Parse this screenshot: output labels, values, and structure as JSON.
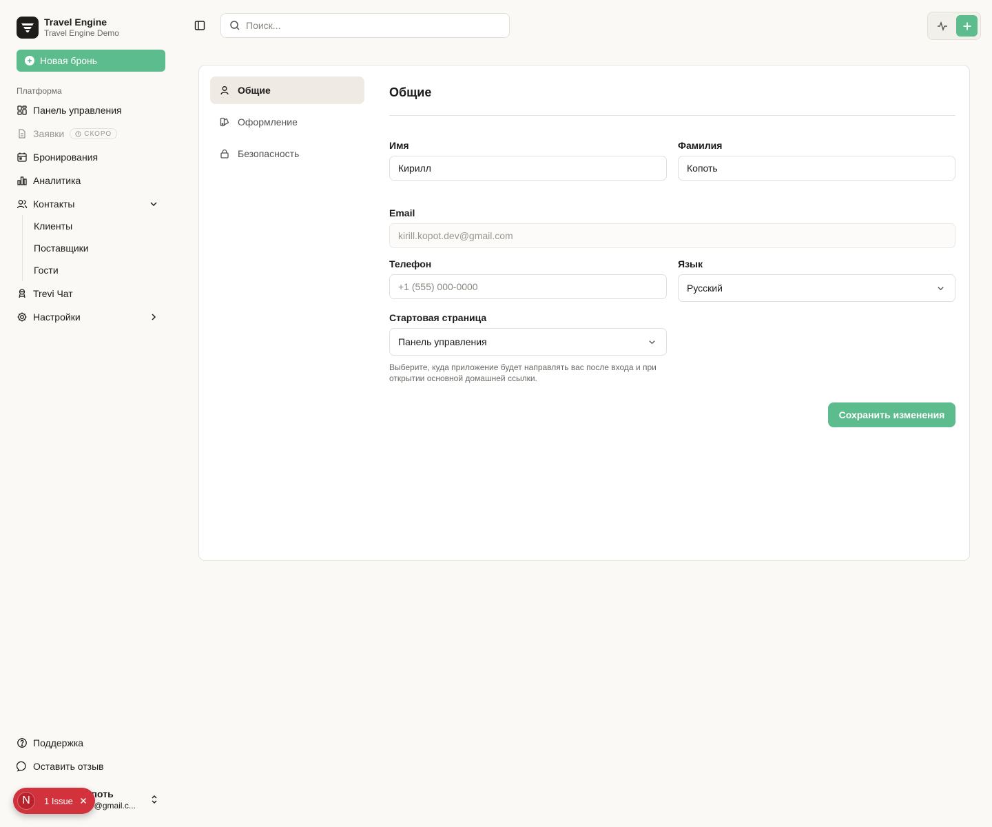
{
  "app": {
    "name": "Travel Engine",
    "workspace": "Travel Engine Demo"
  },
  "sidebar": {
    "new_booking_label": "Новая бронь",
    "group_label": "Платформа",
    "items": {
      "dashboard": "Панель управления",
      "requests": "Заявки",
      "requests_badge": "СКОРО",
      "bookings": "Бронирования",
      "analytics": "Аналитика",
      "contacts": "Контакты",
      "trevi_chat": "Trevi Чат",
      "settings": "Настройки"
    },
    "contacts_sub": {
      "clients": "Клиенты",
      "suppliers": "Поставщики",
      "guests": "Гости"
    },
    "footer": {
      "support": "Поддержка",
      "feedback": "Оставить отзыв"
    },
    "user": {
      "name_visible": "опоть",
      "email_visible": "ev@gmail.c..."
    },
    "issue": {
      "letter": "N",
      "label": "1 Issue"
    }
  },
  "topbar": {
    "search_placeholder": "Поиск..."
  },
  "settings_nav": {
    "general": "Общие",
    "appearance": "Оформление",
    "security": "Безопасность"
  },
  "form": {
    "title": "Общие",
    "first_name_label": "Имя",
    "first_name_value": "Кирилл",
    "last_name_label": "Фамилия",
    "last_name_value": "Копоть",
    "email_label": "Email",
    "email_value": "kirill.kopot.dev@gmail.com",
    "phone_label": "Телефон",
    "phone_placeholder": "+1 (555) 000-0000",
    "language_label": "Язык",
    "language_value": "Русский",
    "start_page_label": "Стартовая страница",
    "start_page_value": "Панель управления",
    "start_page_hint": "Выберите, куда приложение будет направлять вас после входа и при открытии основной домашней ссылки.",
    "save_label": "Сохранить изменения"
  },
  "colors": {
    "accent": "#5cbc8d",
    "background": "#faf9f6",
    "issue": "#d1323b",
    "active_nav": "#efebe4"
  }
}
